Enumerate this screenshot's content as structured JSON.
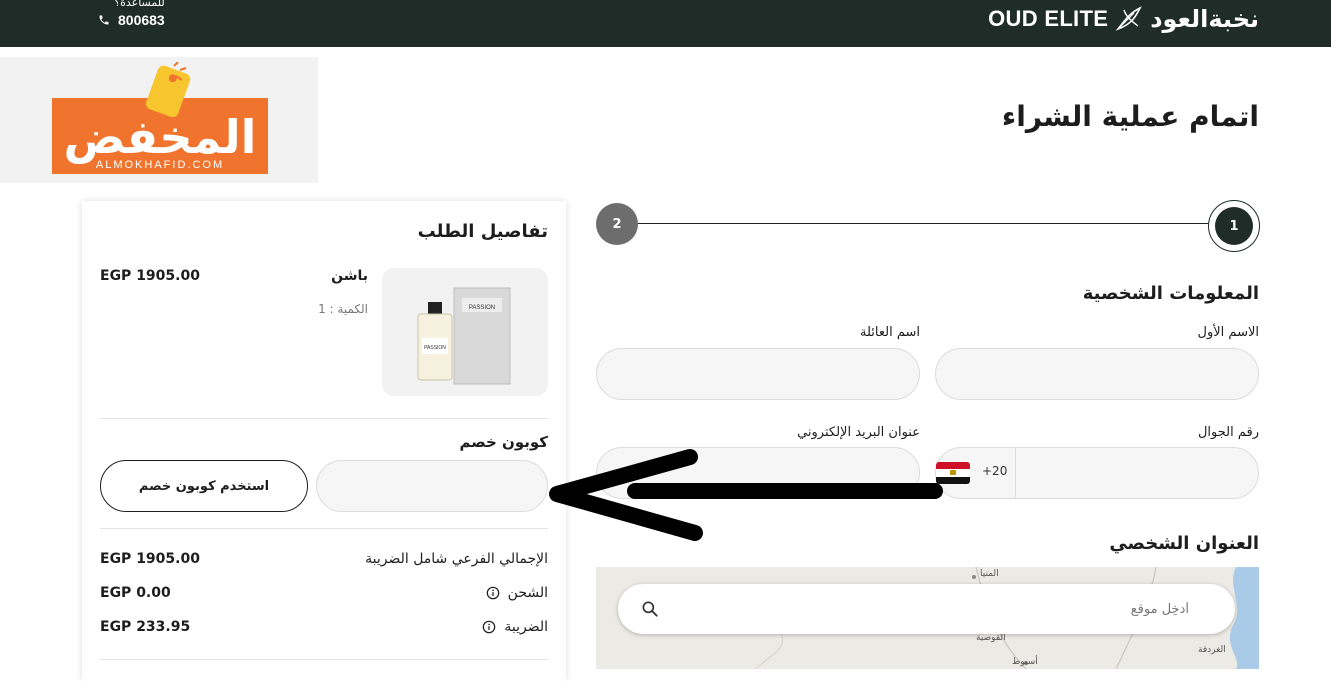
{
  "header": {
    "brand_en": "OUD ELITE",
    "brand_ar": "نخبةالعود",
    "support_label": "للمساعدة؟",
    "support_phone": "800683",
    "bg_color": "#1f2c28"
  },
  "watermark": {
    "logo_text": "المخفض",
    "logo_sub": "ALMOKHAFID.COM",
    "accent": "#f0742d"
  },
  "page": {
    "title": "اتمام عملية الشراء"
  },
  "stepper": {
    "step1": "1",
    "step2": "2"
  },
  "personal_info": {
    "title": "المعلومات الشخصية",
    "first_name_label": "الاسم الأول",
    "last_name_label": "اسم العائلة",
    "mobile_label": "رقم الجوال",
    "email_label": "عنوان البريد الإلكتروني",
    "dial_code": "+20",
    "country_flag": "egypt-flag"
  },
  "address": {
    "title": "العنوان الشخصي",
    "search_placeholder": "أدخِل موقع",
    "places": [
      "المنيا",
      "القوصية",
      "أسيوط",
      "الغردقة"
    ]
  },
  "order": {
    "title": "تفاصيل الطلب",
    "product_name": "باشن",
    "product_qty": "الكمية : 1",
    "product_price": "EGP 1905.00",
    "product_image_brand": "PASSION",
    "coupon_title": "كوبون خصم",
    "coupon_button": "استخدم كوبون خصم",
    "summary": [
      {
        "label": "الإجمالي الفرعي شامل الضريبة",
        "value": "EGP 1905.00",
        "info": false
      },
      {
        "label": "الشحن",
        "value": "EGP 0.00",
        "info": true
      },
      {
        "label": "الضريبة",
        "value": "EGP 233.95",
        "info": true
      }
    ]
  }
}
